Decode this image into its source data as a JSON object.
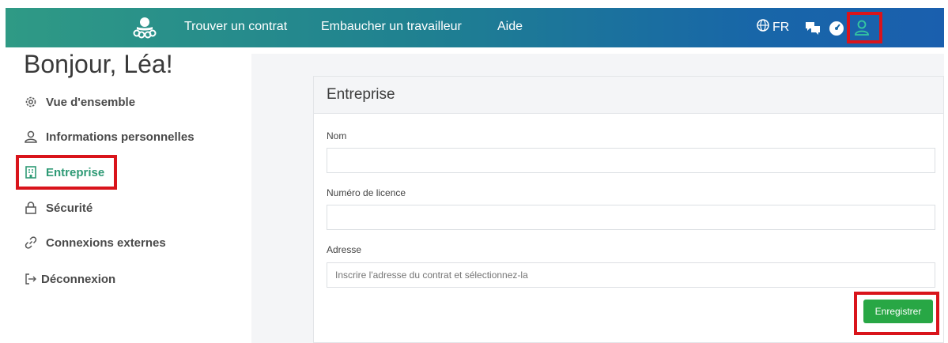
{
  "nav": {
    "links": [
      "Trouver un contrat",
      "Embaucher un travailleur",
      "Aide"
    ],
    "language": "FR",
    "icons": [
      "logo-octopus-icon",
      "globe-icon",
      "chat-icon",
      "dashboard-icon",
      "user-icon"
    ]
  },
  "greeting": "Bonjour, Léa!",
  "sidebar": {
    "items": [
      {
        "label": "Vue d'ensemble",
        "icon": "gear-icon"
      },
      {
        "label": "Informations personnelles",
        "icon": "user-icon"
      },
      {
        "label": "Entreprise",
        "icon": "building-icon",
        "active": true
      },
      {
        "label": "Sécurité",
        "icon": "lock-icon"
      },
      {
        "label": "Connexions externes",
        "icon": "link-icon"
      },
      {
        "label": "Déconnexion",
        "icon": "logout-icon"
      }
    ]
  },
  "form": {
    "title": "Entreprise",
    "name_label": "Nom",
    "name_value": "",
    "license_label": "Numéro de licence",
    "license_value": "",
    "address_label": "Adresse",
    "address_placeholder": "Inscrire l'adresse du contrat et sélectionnez-la",
    "save_label": "Enregistrer"
  },
  "colors": {
    "accent_green": "#2e9a75",
    "button_green": "#28a745",
    "highlight_red": "#d9141b",
    "nav_gradient_start": "#2f9a85",
    "nav_gradient_end": "#1a5fae"
  }
}
